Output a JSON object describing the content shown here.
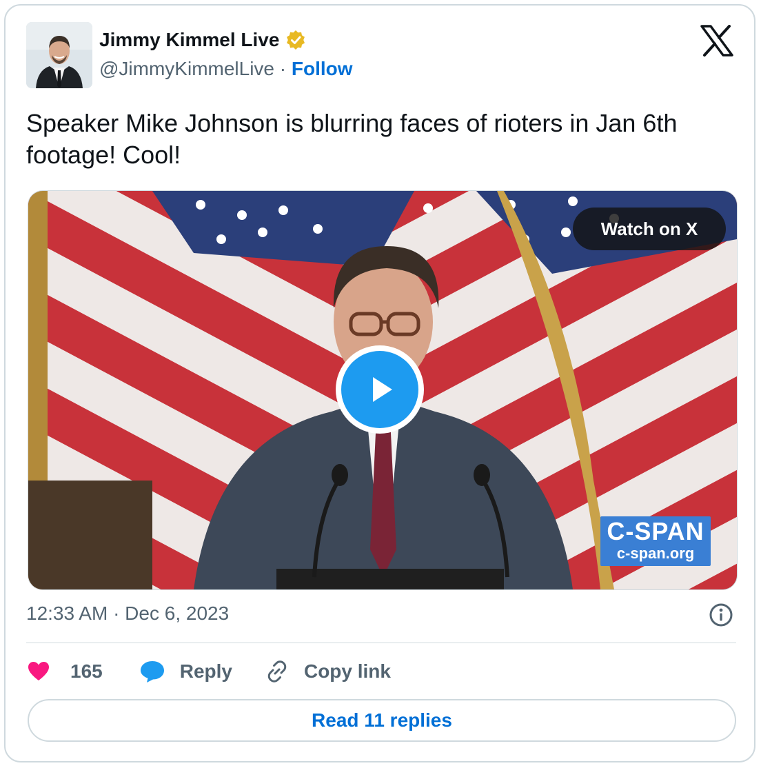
{
  "author": {
    "name": "Jimmy Kimmel Live",
    "handle": "@JimmyKimmelLive",
    "separator": "·",
    "follow_label": "Follow"
  },
  "icons": {
    "brand": "x-logo-icon",
    "verified": "verified-badge-icon",
    "play": "play-icon",
    "info": "info-icon",
    "like": "heart-icon",
    "reply": "speech-bubble-icon",
    "copy": "link-icon"
  },
  "tweet": {
    "text": "Speaker Mike Johnson is blurring faces of rioters in Jan 6th footage! Cool!"
  },
  "media": {
    "watch_label": "Watch on X",
    "watermark_logo": "C-SPAN",
    "watermark_url": "c-span.org"
  },
  "timestamp": "12:33 AM · Dec 6, 2023",
  "actions": {
    "like_count": "165",
    "reply_label": "Reply",
    "copy_label": "Copy link"
  },
  "read_replies_label": "Read 11 replies",
  "colors": {
    "link_blue": "#006fd6",
    "play_blue": "#1d9bf0",
    "like_pink": "#f91880",
    "verified_gold": "#e8b923",
    "muted_text": "#536471",
    "border": "#cfd9de"
  }
}
